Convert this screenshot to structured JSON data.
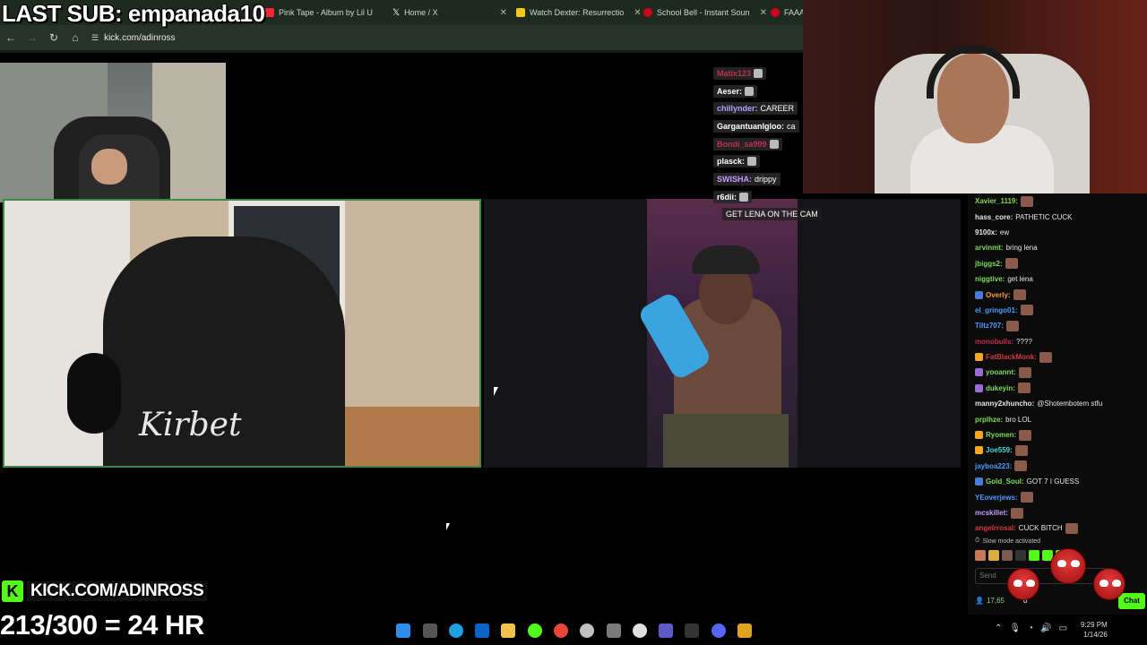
{
  "overlay": {
    "last_sub": "LAST SUB: empanada10",
    "kick_banner": "KICK.COM/ADINROSS",
    "kick_logo": "K",
    "sub_goal": "213/300 = 24 HR"
  },
  "browser": {
    "tabs": [
      {
        "label": "Pink Tape - Album by Lil U",
        "color": "#fa243c"
      },
      {
        "label": "Home / X",
        "color": "#ffffff"
      },
      {
        "label": "Watch Dexter: Resurrectio",
        "color": "#f5c518"
      },
      {
        "label": "School Bell - Instant Soun",
        "color": "#d0021b"
      },
      {
        "label": "FAAAH",
        "color": "#d0021b"
      }
    ],
    "url": "kick.com/adinross"
  },
  "overlay_chat": [
    {
      "name": "Matix123",
      "text": "",
      "color": "#c03050"
    },
    {
      "name": "Aeser:",
      "text": "",
      "color": "#ffffff"
    },
    {
      "name": "chillynder:",
      "text": "CAREER",
      "color": "#b0a0ff"
    },
    {
      "name": "GargantuanIgloo:",
      "text": "ca",
      "color": "#ffffff"
    },
    {
      "name": "Bondi_sa999",
      "text": "",
      "color": "#c03050"
    },
    {
      "name": "plasck:",
      "text": "",
      "color": "#ffffff"
    },
    {
      "name": "SWISHA:",
      "text": "drippy",
      "color": "#c79aff"
    },
    {
      "name": "r6dii:",
      "text": "",
      "color": "#ffffff"
    }
  ],
  "center_message": {
    "name": "",
    "text": "GET LENA ON THE CAM"
  },
  "chat": {
    "lines": [
      {
        "name": "Xavier_1119:",
        "text": "",
        "color": "#7ed957",
        "badge": "",
        "emote": true
      },
      {
        "name": "hass_core:",
        "text": "PATHETIC CUCK",
        "color": "#e6e6e6",
        "badge": "",
        "emote": false
      },
      {
        "name": "9100x:",
        "text": "ew",
        "color": "#e6e6e6",
        "badge": "",
        "emote": false
      },
      {
        "name": "arvinmt:",
        "text": "bring lena",
        "color": "#7ed957",
        "badge": "",
        "emote": false
      },
      {
        "name": "jbiggs2:",
        "text": "",
        "color": "#7ed957",
        "badge": "",
        "emote": true
      },
      {
        "name": "niggtive:",
        "text": "get lena",
        "color": "#7ed957",
        "badge": "",
        "emote": false
      },
      {
        "name": "Overly:",
        "text": "",
        "color": "#ff9a3c",
        "badge": "#4b7bd8",
        "emote": true
      },
      {
        "name": "el_gringo01:",
        "text": "",
        "color": "#4b9bff",
        "badge": "",
        "emote": true
      },
      {
        "name": "Tiltz707:",
        "text": "",
        "color": "#4b9bff",
        "badge": "",
        "emote": true
      },
      {
        "name": "monobulls:",
        "text": "????",
        "color": "#c03050",
        "badge": "",
        "emote": false
      },
      {
        "name": "FatBlackMonk:",
        "text": "",
        "color": "#d23a3a",
        "badge": "#f5a623",
        "emote": true
      },
      {
        "name": "yooannt:",
        "text": "",
        "color": "#7ed957",
        "badge": "#9b6bd8",
        "emote": true
      },
      {
        "name": "dukeyin:",
        "text": "",
        "color": "#7ed957",
        "badge": "#9b6bd8",
        "emote": true
      },
      {
        "name": "manny2xhuncho:",
        "text": "@Shotembotem stfu",
        "color": "#e6e6e6",
        "badge": "",
        "emote": false
      },
      {
        "name": "prplhze:",
        "text": "bro LOL",
        "color": "#7ed957",
        "badge": "",
        "emote": false
      },
      {
        "name": "Ryomen:",
        "text": "",
        "color": "#7ed957",
        "badge": "#f5a623",
        "emote": true
      },
      {
        "name": "Joe559:",
        "text": "",
        "color": "#4bd8d8",
        "badge": "#f5a623",
        "emote": true
      },
      {
        "name": "jayboa223:",
        "text": "",
        "color": "#4b9bff",
        "badge": "",
        "emote": true
      },
      {
        "name": "Gold_Soul:",
        "text": "GOT 7 I GUESS",
        "color": "#7ed957",
        "badge": "#4b7bd8",
        "emote": false
      },
      {
        "name": "YEoverjews:",
        "text": "",
        "color": "#4b9bff",
        "badge": "",
        "emote": true
      },
      {
        "name": "mcskillet:",
        "text": "",
        "color": "#c79aff",
        "badge": "",
        "emote": true
      },
      {
        "name": "angelrrosal:",
        "text": "CUCK BITCH",
        "color": "#d23a3a",
        "badge": "",
        "emote": true
      }
    ],
    "slow_mode": "Slow mode activated",
    "send_placeholder": "Send",
    "viewers": "17,65",
    "viewer_count_small": "0",
    "chat_button": "Chat"
  },
  "taskbar": {
    "time": "9:29 PM",
    "date": "1/14/26"
  }
}
